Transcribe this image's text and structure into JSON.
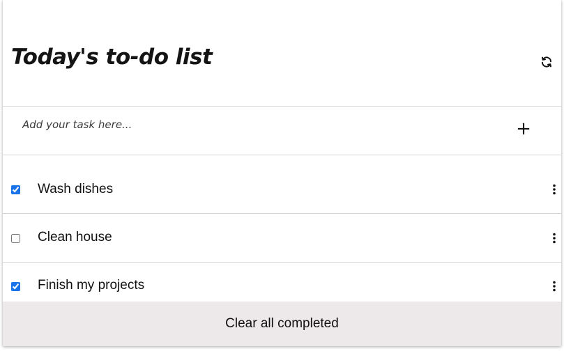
{
  "header": {
    "title": "Today's to-do list",
    "refresh_icon": "refresh-icon"
  },
  "add_task": {
    "placeholder": "Add your task here...",
    "value": "",
    "add_icon": "plus-icon",
    "add_symbol": "+"
  },
  "tasks": [
    {
      "label": "Wash dishes",
      "completed": true,
      "menu_icon": "more-vertical-icon"
    },
    {
      "label": "Clean house",
      "completed": false,
      "menu_icon": "more-vertical-icon"
    },
    {
      "label": "Finish my projects",
      "completed": true,
      "menu_icon": "more-vertical-icon"
    }
  ],
  "footer": {
    "clear_label": "Clear all completed",
    "background_color": "#ede8ea"
  },
  "colors": {
    "checkbox_accent": "#1a73e8",
    "divider": "#d6d6d6",
    "text": "#111111"
  }
}
